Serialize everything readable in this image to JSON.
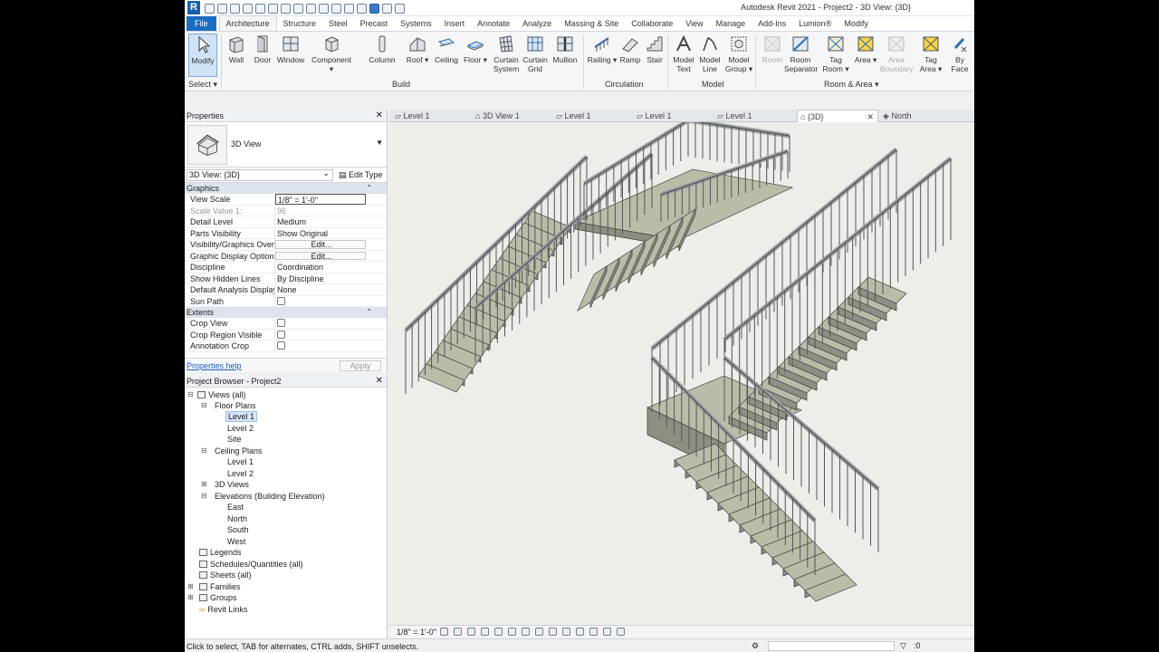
{
  "window": {
    "title": "Autodesk Revit 2021 - Project2 - 3D View: {3D}",
    "logo": "R"
  },
  "ribbon_tabs": [
    "File",
    "Architecture",
    "Structure",
    "Steel",
    "Precast",
    "Systems",
    "Insert",
    "Annotate",
    "Analyze",
    "Massing & Site",
    "Collaborate",
    "View",
    "Manage",
    "Add-Ins",
    "Lumion®",
    "Modify"
  ],
  "ribbon": {
    "select_label": "Select",
    "buttons": [
      {
        "label": "Modify"
      },
      {
        "label": "Wall"
      },
      {
        "label": "Door"
      },
      {
        "label": "Window"
      },
      {
        "label": "Component"
      },
      {
        "label": "Column"
      },
      {
        "label": "Roof"
      },
      {
        "label": "Ceiling"
      },
      {
        "label": "Floor"
      },
      {
        "label": "Curtain System"
      },
      {
        "label": "Curtain Grid"
      },
      {
        "label": "Mullion"
      },
      {
        "label": "Railing"
      },
      {
        "label": "Ramp"
      },
      {
        "label": "Stair"
      },
      {
        "label": "Model Text"
      },
      {
        "label": "Model Line"
      },
      {
        "label": "Model Group"
      },
      {
        "label": "Room"
      },
      {
        "label": "Room Separator"
      },
      {
        "label": "Tag Room"
      },
      {
        "label": "Area"
      },
      {
        "label": "Area Boundary"
      },
      {
        "label": "Tag Area"
      },
      {
        "label": "By Face"
      }
    ],
    "panels": [
      "Build",
      "Circulation",
      "Model",
      "Room & Area"
    ]
  },
  "properties": {
    "title": "Properties",
    "type_name": "3D View",
    "instance": "3D View: {3D}",
    "edit_type": "Edit Type",
    "groups": [
      {
        "name": "Graphics",
        "rows": [
          {
            "name": "View Scale",
            "value": "1/8\" = 1'-0\""
          },
          {
            "name": "Scale Value    1:",
            "value": "96"
          },
          {
            "name": "Detail Level",
            "value": "Medium"
          },
          {
            "name": "Parts Visibility",
            "value": "Show Original"
          },
          {
            "name": "Visibility/Graphics Over...",
            "value": "Edit..."
          },
          {
            "name": "Graphic Display Options",
            "value": "Edit..."
          },
          {
            "name": "Discipline",
            "value": "Coordination"
          },
          {
            "name": "Show Hidden Lines",
            "value": "By Discipline"
          },
          {
            "name": "Default Analysis Display...",
            "value": "None"
          },
          {
            "name": "Sun Path",
            "value": ""
          }
        ]
      },
      {
        "name": "Extents",
        "rows": [
          {
            "name": "Crop View",
            "value": ""
          },
          {
            "name": "Crop Region Visible",
            "value": ""
          },
          {
            "name": "Annotation Crop",
            "value": ""
          }
        ]
      }
    ],
    "help": "Properties help",
    "apply": "Apply"
  },
  "browser": {
    "title": "Project Browser - Project2",
    "nodes": [
      {
        "label": "Views (all)"
      },
      {
        "label": "Floor Plans"
      },
      {
        "label": "Level 1"
      },
      {
        "label": "Level 2"
      },
      {
        "label": "Site"
      },
      {
        "label": "Ceiling Plans"
      },
      {
        "label": "Level 1"
      },
      {
        "label": "Level 2"
      },
      {
        "label": "3D Views"
      },
      {
        "label": "Elevations (Building Elevation)"
      },
      {
        "label": "East"
      },
      {
        "label": "North"
      },
      {
        "label": "South"
      },
      {
        "label": "West"
      },
      {
        "label": "Legends"
      },
      {
        "label": "Schedules/Quantities (all)"
      },
      {
        "label": "Sheets (all)"
      },
      {
        "label": "Families"
      },
      {
        "label": "Groups"
      },
      {
        "label": "Revit Links"
      }
    ]
  },
  "view_tabs": [
    "Level 1",
    "3D View 1",
    "Level 1",
    "Level 1",
    "Level 1",
    "{3D}",
    "North"
  ],
  "view_bar": {
    "scale": "1/8\" = 1'-0\""
  },
  "status": {
    "message": "Click to select, TAB for alternates, CTRL adds, SHIFT unselects.",
    "count": ":0"
  },
  "colors": {
    "accent": "#1a6ec1",
    "tread": "#b9bda8",
    "rail": "#9aa0a2",
    "canvas": "#ededea"
  }
}
